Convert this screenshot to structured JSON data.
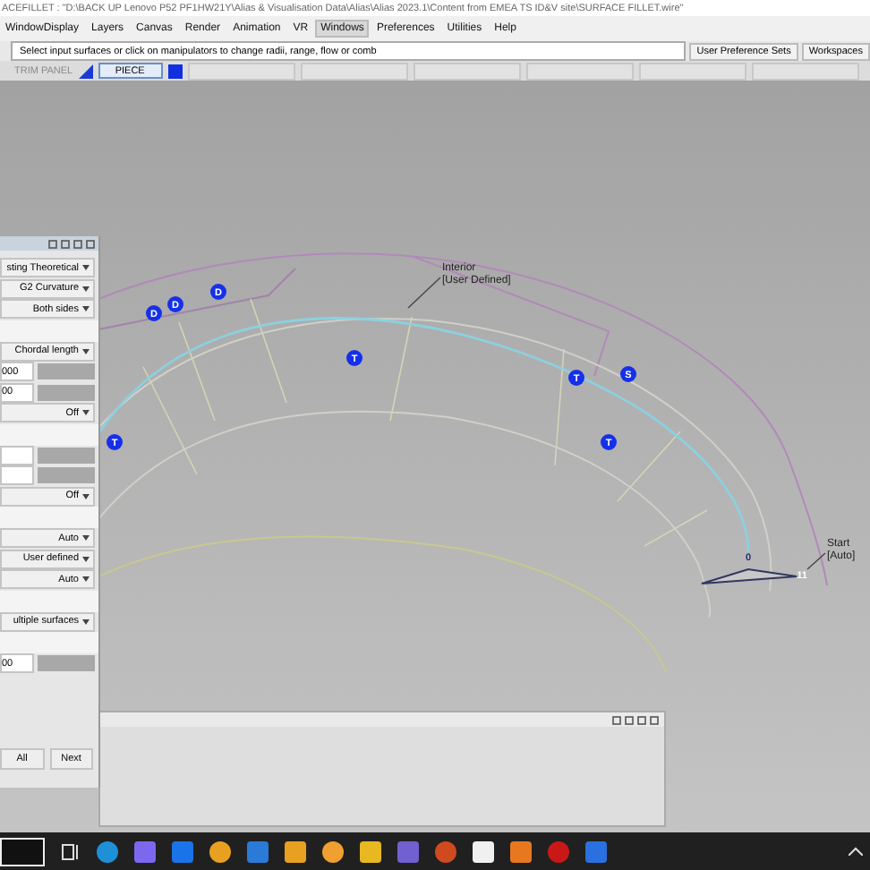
{
  "title_bar": {
    "title": "ACEFILLET : \"D:\\BACK UP Lenovo P52 PF1HW21Y\\Alias & Visualisation Data\\Alias\\Alias 2023.1\\Content from EMEA TS ID&V site\\SURFACE FILLET.wire\""
  },
  "menu_bar": [
    {
      "label": "WindowDisplay",
      "selected": false
    },
    {
      "label": "Layers",
      "selected": false
    },
    {
      "label": "Canvas",
      "selected": false
    },
    {
      "label": "Render",
      "selected": false
    },
    {
      "label": "Animation",
      "selected": false
    },
    {
      "label": "VR",
      "selected": false
    },
    {
      "label": "Windows",
      "selected": true
    },
    {
      "label": "Preferences",
      "selected": false
    },
    {
      "label": "Utilities",
      "selected": false
    },
    {
      "label": "Help",
      "selected": false
    }
  ],
  "prompt": {
    "text": "Select input surfaces or click on manipulators to change radii, range, flow or comb",
    "buttons": [
      "User Preference Sets",
      "Workspaces"
    ]
  },
  "toolbar": {
    "label": "TRIM PANEL",
    "tabs": [
      {
        "label": "PIECE",
        "selected": true
      }
    ]
  },
  "viewport": {
    "labels": [
      {
        "lines": [
          "Interior",
          "[User Defined]"
        ]
      },
      {
        "lines": [
          "Start",
          "[Auto]"
        ]
      }
    ],
    "markers": [
      {
        "label": "D"
      },
      {
        "label": "D"
      },
      {
        "label": "D"
      },
      {
        "label": "T"
      },
      {
        "label": "T"
      },
      {
        "label": "T"
      },
      {
        "label": "T"
      },
      {
        "label": "S"
      },
      {
        "label": "0"
      },
      {
        "label": "11"
      }
    ]
  },
  "option_panel": {
    "rows": [
      {
        "kind": "dropdown",
        "value": "sting Theoretical"
      },
      {
        "kind": "dropdown",
        "value": "G2 Curvature"
      },
      {
        "kind": "dropdown",
        "value": "Both sides"
      },
      {
        "kind": "section"
      },
      {
        "kind": "dropdown",
        "value": "Chordal length"
      },
      {
        "kind": "field",
        "value": "000"
      },
      {
        "kind": "field",
        "value": "00"
      },
      {
        "kind": "dropdown",
        "value": "Off"
      },
      {
        "kind": "section"
      },
      {
        "kind": "field"
      },
      {
        "kind": "field"
      },
      {
        "kind": "dropdown",
        "value": "Off"
      },
      {
        "kind": "section"
      },
      {
        "kind": "dropdown",
        "value": "Auto"
      },
      {
        "kind": "dropdown",
        "value": "User defined"
      },
      {
        "kind": "dropdown",
        "value": "Auto"
      },
      {
        "kind": "section"
      },
      {
        "kind": "dropdown",
        "value": "ultiple surfaces"
      },
      {
        "kind": "section"
      },
      {
        "kind": "field",
        "value": "00"
      }
    ],
    "buttons": [
      "All",
      "Next"
    ]
  }
}
